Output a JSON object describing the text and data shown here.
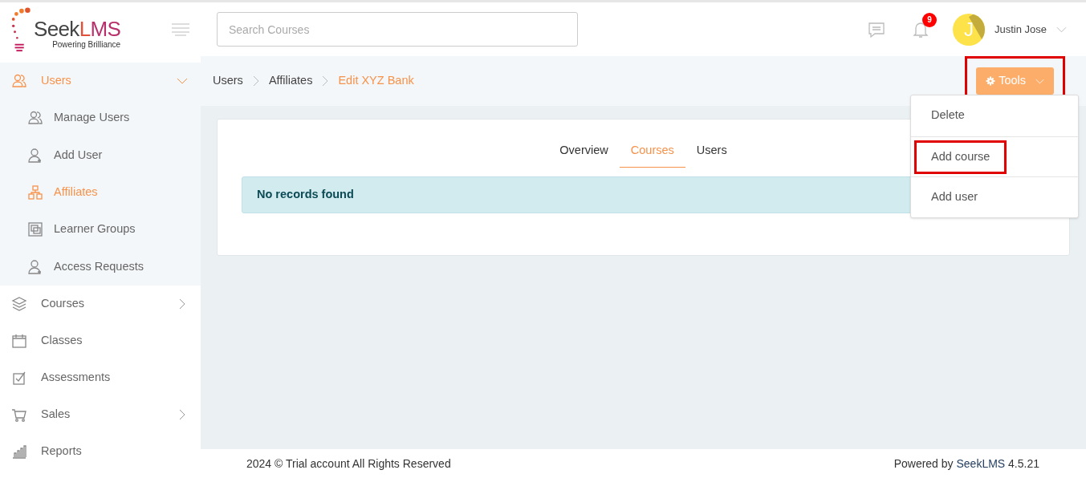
{
  "logo": {
    "name_dark": "Seek",
    "name_accent": "LMS",
    "tagline": "Powering Brilliance"
  },
  "search": {
    "placeholder": "Search Courses"
  },
  "notifications": {
    "count": "9"
  },
  "user": {
    "name": "Justin Jose",
    "initial": "J"
  },
  "sidebar": {
    "items": [
      {
        "label": "Users",
        "selected": true,
        "expanded": true,
        "has_children": true,
        "children": [
          {
            "label": "Manage Users",
            "selected": false
          },
          {
            "label": "Add User",
            "selected": false
          },
          {
            "label": "Affiliates",
            "selected": true
          },
          {
            "label": "Learner Groups",
            "selected": false
          },
          {
            "label": "Access Requests",
            "selected": false
          }
        ]
      },
      {
        "label": "Courses",
        "selected": false,
        "expanded": false,
        "has_children": true
      },
      {
        "label": "Classes",
        "selected": false,
        "has_children": false
      },
      {
        "label": "Assessments",
        "selected": false,
        "has_children": false
      },
      {
        "label": "Sales",
        "selected": false,
        "expanded": false,
        "has_children": true
      },
      {
        "label": "Reports",
        "selected": false,
        "has_children": false
      }
    ]
  },
  "breadcrumb": [
    "Users",
    "Affiliates",
    "Edit XYZ Bank"
  ],
  "tools": {
    "label": "Tools",
    "highlighted": true,
    "expanded": true,
    "menu": [
      {
        "label": "Delete",
        "highlighted": false
      },
      {
        "label": "Add course",
        "highlighted": true
      },
      {
        "label": "Add user",
        "highlighted": false
      }
    ]
  },
  "tabs": [
    {
      "label": "Overview",
      "selected": false
    },
    {
      "label": "Courses",
      "selected": true
    },
    {
      "label": "Users",
      "selected": false
    }
  ],
  "alert": "No records found",
  "footer": {
    "copyright": "2024 © Trial account All Rights Reserved",
    "powered_prefix": "Powered by ",
    "powered_brand": "SeekLMS",
    "version": " 4.5.21"
  }
}
